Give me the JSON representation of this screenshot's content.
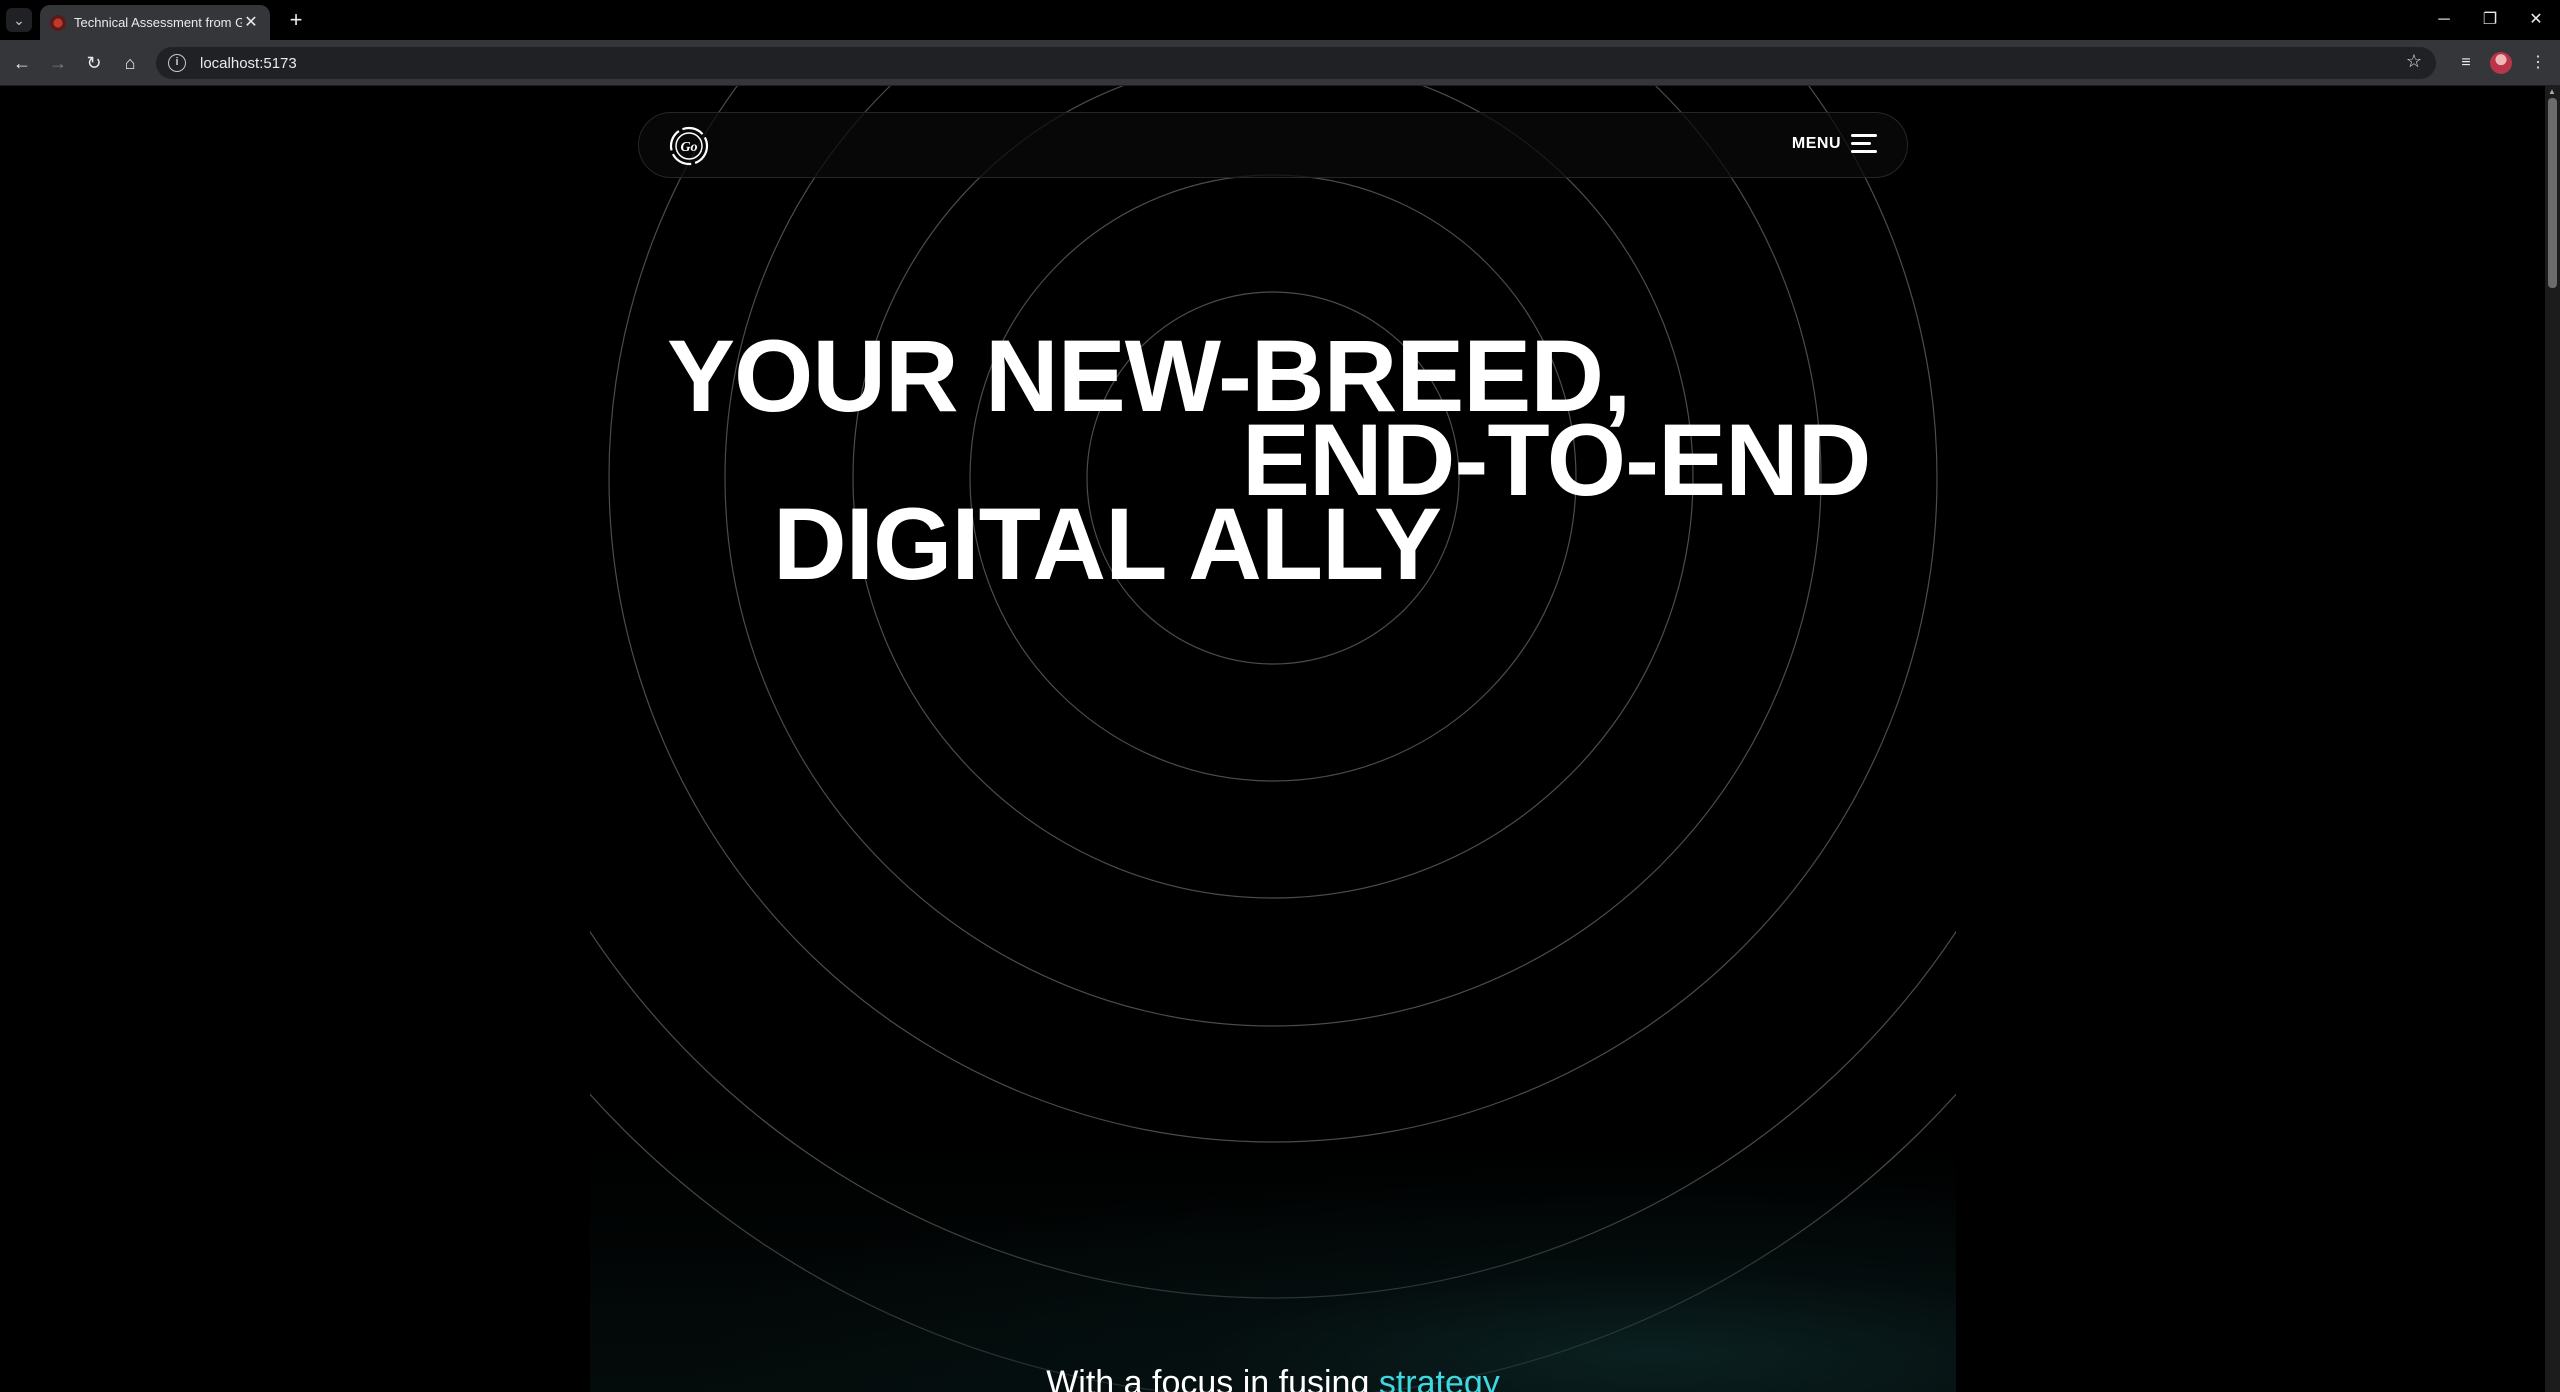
{
  "browser": {
    "tab_title": "Technical Assessment from Gro",
    "tab_close": "✕",
    "new_tab": "+",
    "url": "localhost:5173",
    "window": {
      "minimize": "─",
      "restore": "❐",
      "close": "✕"
    }
  },
  "site": {
    "menu_label": "MENU",
    "logo_text": "Go",
    "hero": {
      "line1": "YOUR NEW-BREED,",
      "line2": "END-TO-END",
      "line3": "DIGITAL ALLY"
    },
    "sub": {
      "text": "With a focus in fusing ",
      "accent": "strategy"
    },
    "colors": {
      "background": "#000000",
      "text": "#ffffff",
      "accent": "#3ed8e0",
      "ring": "#5a5a5a"
    }
  }
}
